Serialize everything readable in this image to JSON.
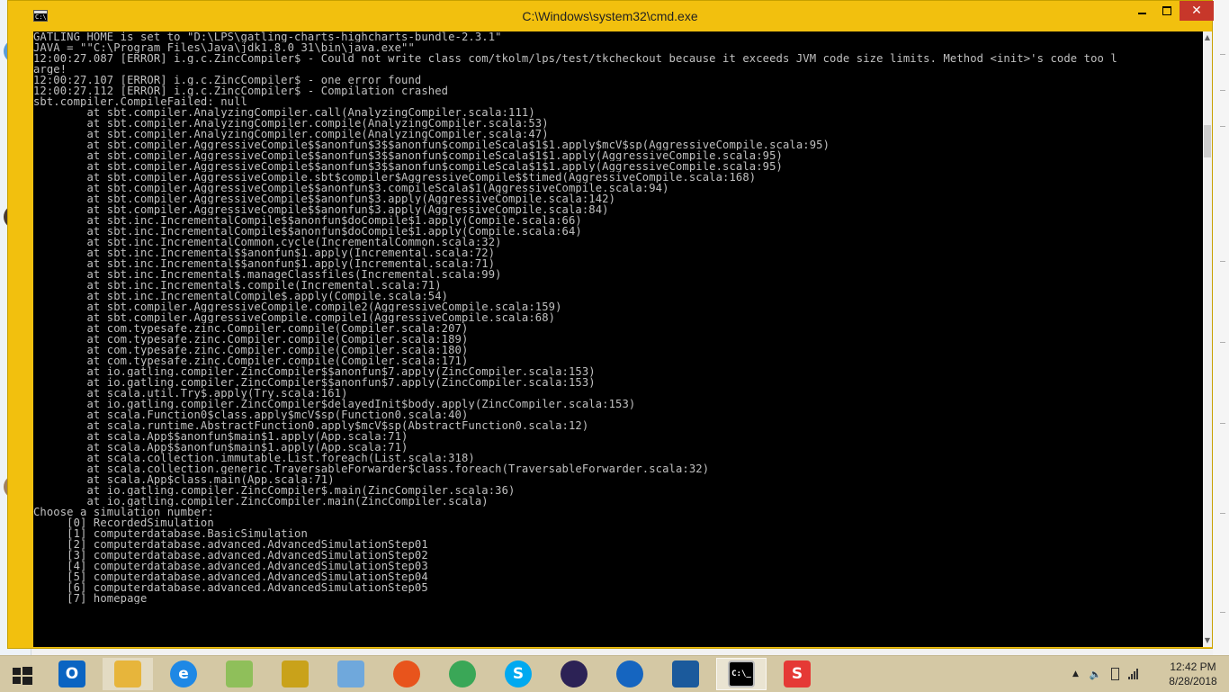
{
  "window": {
    "title": "C:\\Windows\\system32\\cmd.exe",
    "icon_label": "C:\\",
    "controls": {
      "minimize": "minimize",
      "maximize": "maximize",
      "close": "✕"
    }
  },
  "console": {
    "lines": [
      "GATLING_HOME is set to \"D:\\LPS\\gatling-charts-highcharts-bundle-2.3.1\"",
      "JAVA = \"\"C:\\Program Files\\Java\\jdk1.8.0_31\\bin\\java.exe\"\"",
      "12:00:27.087 [ERROR] i.g.c.ZincCompiler$ - Could not write class com/tkolm/lps/test/tkcheckout because it exceeds JVM code size limits. Method <init>'s code too l",
      "arge!",
      "12:00:27.107 [ERROR] i.g.c.ZincCompiler$ - one error found",
      "12:00:27.112 [ERROR] i.g.c.ZincCompiler$ - Compilation crashed",
      "sbt.compiler.CompileFailed: null",
      "        at sbt.compiler.AnalyzingCompiler.call(AnalyzingCompiler.scala:111)",
      "        at sbt.compiler.AnalyzingCompiler.compile(AnalyzingCompiler.scala:53)",
      "        at sbt.compiler.AnalyzingCompiler.compile(AnalyzingCompiler.scala:47)",
      "        at sbt.compiler.AggressiveCompile$$anonfun$3$$anonfun$compileScala$1$1.apply$mcV$sp(AggressiveCompile.scala:95)",
      "        at sbt.compiler.AggressiveCompile$$anonfun$3$$anonfun$compileScala$1$1.apply(AggressiveCompile.scala:95)",
      "        at sbt.compiler.AggressiveCompile$$anonfun$3$$anonfun$compileScala$1$1.apply(AggressiveCompile.scala:95)",
      "        at sbt.compiler.AggressiveCompile.sbt$compiler$AggressiveCompile$$timed(AggressiveCompile.scala:168)",
      "        at sbt.compiler.AggressiveCompile$$anonfun$3.compileScala$1(AggressiveCompile.scala:94)",
      "        at sbt.compiler.AggressiveCompile$$anonfun$3.apply(AggressiveCompile.scala:142)",
      "        at sbt.compiler.AggressiveCompile$$anonfun$3.apply(AggressiveCompile.scala:84)",
      "        at sbt.inc.IncrementalCompile$$anonfun$doCompile$1.apply(Compile.scala:66)",
      "        at sbt.inc.IncrementalCompile$$anonfun$doCompile$1.apply(Compile.scala:64)",
      "        at sbt.inc.IncrementalCommon.cycle(IncrementalCommon.scala:32)",
      "        at sbt.inc.Incremental$$anonfun$1.apply(Incremental.scala:72)",
      "        at sbt.inc.Incremental$$anonfun$1.apply(Incremental.scala:71)",
      "        at sbt.inc.Incremental$.manageClassfiles(Incremental.scala:99)",
      "        at sbt.inc.Incremental$.compile(Incremental.scala:71)",
      "        at sbt.inc.IncrementalCompile$.apply(Compile.scala:54)",
      "        at sbt.compiler.AggressiveCompile.compile2(AggressiveCompile.scala:159)",
      "        at sbt.compiler.AggressiveCompile.compile1(AggressiveCompile.scala:68)",
      "        at com.typesafe.zinc.Compiler.compile(Compiler.scala:207)",
      "        at com.typesafe.zinc.Compiler.compile(Compiler.scala:189)",
      "        at com.typesafe.zinc.Compiler.compile(Compiler.scala:180)",
      "        at com.typesafe.zinc.Compiler.compile(Compiler.scala:171)",
      "        at io.gatling.compiler.ZincCompiler$$anonfun$7.apply(ZincCompiler.scala:153)",
      "        at io.gatling.compiler.ZincCompiler$$anonfun$7.apply(ZincCompiler.scala:153)",
      "        at scala.util.Try$.apply(Try.scala:161)",
      "        at io.gatling.compiler.ZincCompiler$delayedInit$body.apply(ZincCompiler.scala:153)",
      "        at scala.Function0$class.apply$mcV$sp(Function0.scala:40)",
      "        at scala.runtime.AbstractFunction0.apply$mcV$sp(AbstractFunction0.scala:12)",
      "        at scala.App$$anonfun$main$1.apply(App.scala:71)",
      "        at scala.App$$anonfun$main$1.apply(App.scala:71)",
      "        at scala.collection.immutable.List.foreach(List.scala:318)",
      "        at scala.collection.generic.TraversableForwarder$class.foreach(TraversableForwarder.scala:32)",
      "        at scala.App$class.main(App.scala:71)",
      "        at io.gatling.compiler.ZincCompiler$.main(ZincCompiler.scala:36)",
      "        at io.gatling.compiler.ZincCompiler.main(ZincCompiler.scala)",
      "Choose a simulation number:",
      "     [0] RecordedSimulation",
      "     [1] computerdatabase.BasicSimulation",
      "     [2] computerdatabase.advanced.AdvancedSimulationStep01",
      "     [3] computerdatabase.advanced.AdvancedSimulationStep02",
      "     [4] computerdatabase.advanced.AdvancedSimulationStep03",
      "     [5] computerdatabase.advanced.AdvancedSimulationStep04",
      "     [6] computerdatabase.advanced.AdvancedSimulationStep05",
      "     [7] homepage"
    ]
  },
  "taskbar": {
    "apps": [
      {
        "name": "outlook-icon",
        "label": "O",
        "color": "#0a64c2"
      },
      {
        "name": "file-explorer-icon",
        "label": "",
        "color": "#e7b53b"
      },
      {
        "name": "internet-explorer-icon",
        "label": "e",
        "color": "#1e88e5"
      },
      {
        "name": "folder-icon",
        "label": "",
        "color": "#8fbf5a"
      },
      {
        "name": "lock-icon",
        "label": "",
        "color": "#c9a21a"
      },
      {
        "name": "notepad-icon",
        "label": "",
        "color": "#6fa8dc"
      },
      {
        "name": "firefox-icon",
        "label": "",
        "color": "#e8541c"
      },
      {
        "name": "chrome-icon",
        "label": "",
        "color": "#3aa757"
      },
      {
        "name": "skype-icon",
        "label": "S",
        "color": "#00a9f0"
      },
      {
        "name": "eclipse-icon",
        "label": "",
        "color": "#2c2255"
      },
      {
        "name": "maps-pin-icon",
        "label": "",
        "color": "#1565c0"
      },
      {
        "name": "virtualbox-icon",
        "label": "",
        "color": "#1b5a9c"
      },
      {
        "name": "cmd-icon",
        "label": "C:\\_",
        "color": "#000000"
      },
      {
        "name": "sublime-icon",
        "label": "S",
        "color": "#e53935"
      }
    ],
    "clock": {
      "time": "12:42 PM",
      "date": "8/28/2018"
    }
  }
}
